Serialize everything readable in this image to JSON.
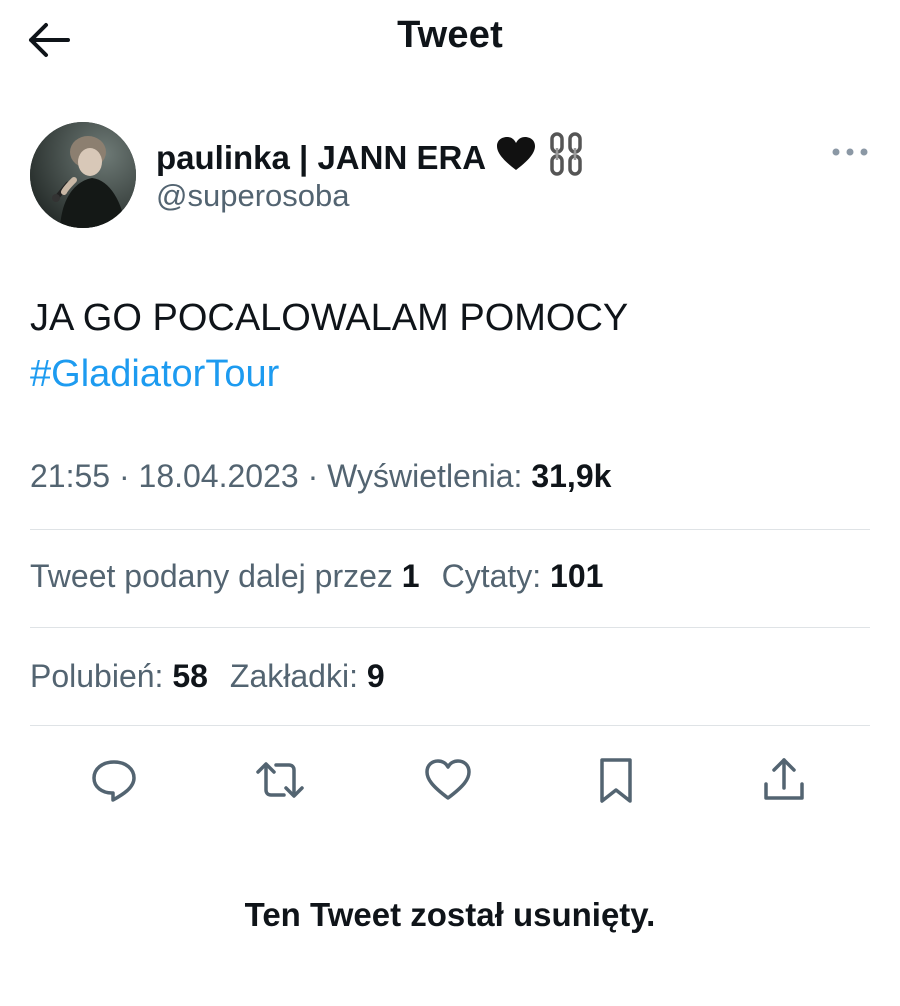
{
  "header": {
    "title": "Tweet",
    "back_icon": "arrow-left-icon"
  },
  "author": {
    "display_name": "paulinka | JANN ERA",
    "emoji_heart": "🖤",
    "emoji_chain": "⛓",
    "handle": "@superosoba",
    "more_icon": "more-horizontal-icon"
  },
  "tweet": {
    "text": "JA GO POCALOWALAM POMOCY",
    "hashtag": "#GladiatorTour"
  },
  "meta": {
    "time": "21:55",
    "separator": "·",
    "date": "18.04.2023",
    "views_label": "Wyświetlenia:",
    "views_value": "31,9k"
  },
  "stats": {
    "retweets_label": "Tweet podany dalej przez",
    "retweets_value": "1",
    "quotes_label": "Cytaty:",
    "quotes_value": "101",
    "likes_label": "Polubień:",
    "likes_value": "58",
    "bookmarks_label": "Zakładki:",
    "bookmarks_value": "9"
  },
  "actions": [
    "reply-icon",
    "retweet-icon",
    "like-icon",
    "bookmark-icon",
    "share-icon"
  ],
  "notice": "Ten Tweet został usunięty.",
  "colors": {
    "text": "#0f1419",
    "secondary": "#536471",
    "link": "#1d9bf0",
    "divider": "#dfe3e6"
  }
}
